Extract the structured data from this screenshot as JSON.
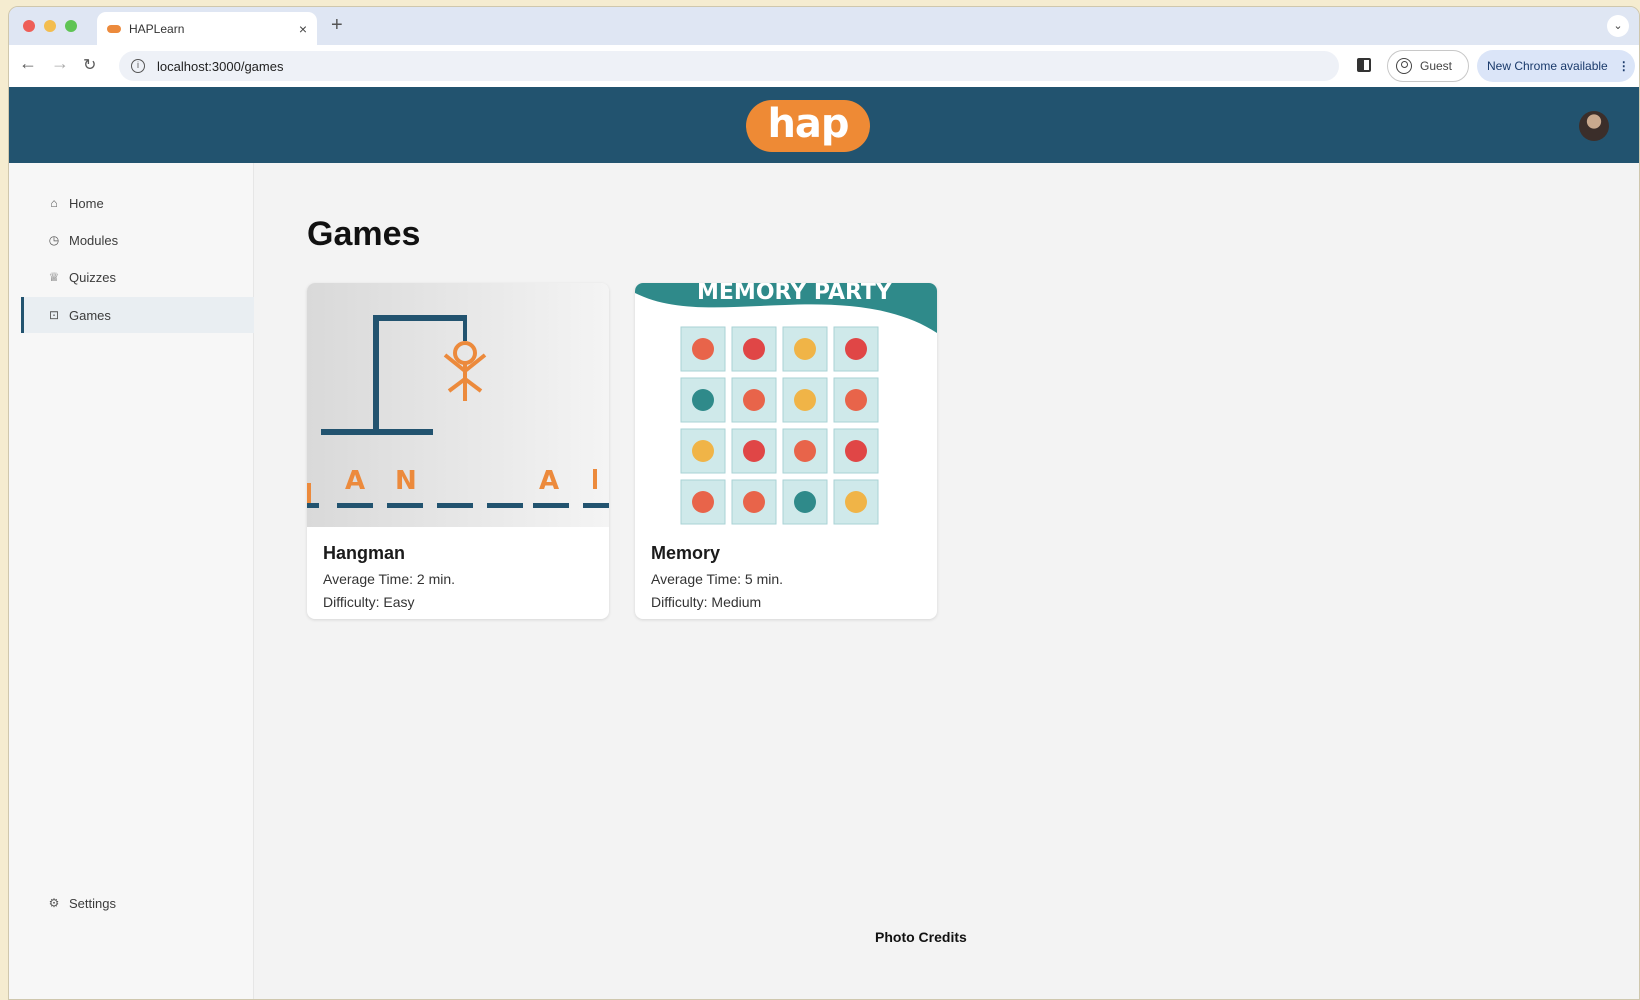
{
  "browser": {
    "tab_title": "HAPLearn",
    "tab_close": "×",
    "new_tab": "+",
    "url": "localhost:3000/games",
    "profile_label": "Guest",
    "update_label": "New Chrome available",
    "menu_dots": "⋮"
  },
  "header": {
    "logo_text": "hap",
    "brand_color": "#22536f",
    "logo_color": "#ee8a35"
  },
  "sidebar": {
    "items": [
      {
        "label": "Home",
        "icon": "home-icon"
      },
      {
        "label": "Modules",
        "icon": "clock-icon"
      },
      {
        "label": "Quizzes",
        "icon": "trophy-icon"
      },
      {
        "label": "Games",
        "icon": "gamepad-icon",
        "active": true
      }
    ],
    "settings_label": "Settings"
  },
  "main": {
    "title": "Games",
    "games": [
      {
        "name": "Hangman",
        "avg_time": "Average Time: 2 min.",
        "difficulty": "Difficulty: Easy",
        "image_letters": [
          "A",
          "N",
          "A"
        ]
      },
      {
        "name": "Memory",
        "avg_time": "Average Time: 5 min.",
        "difficulty": "Difficulty: Medium",
        "image_banner": "MEMORY PARTY"
      }
    ],
    "footer": "Photo Credits"
  }
}
